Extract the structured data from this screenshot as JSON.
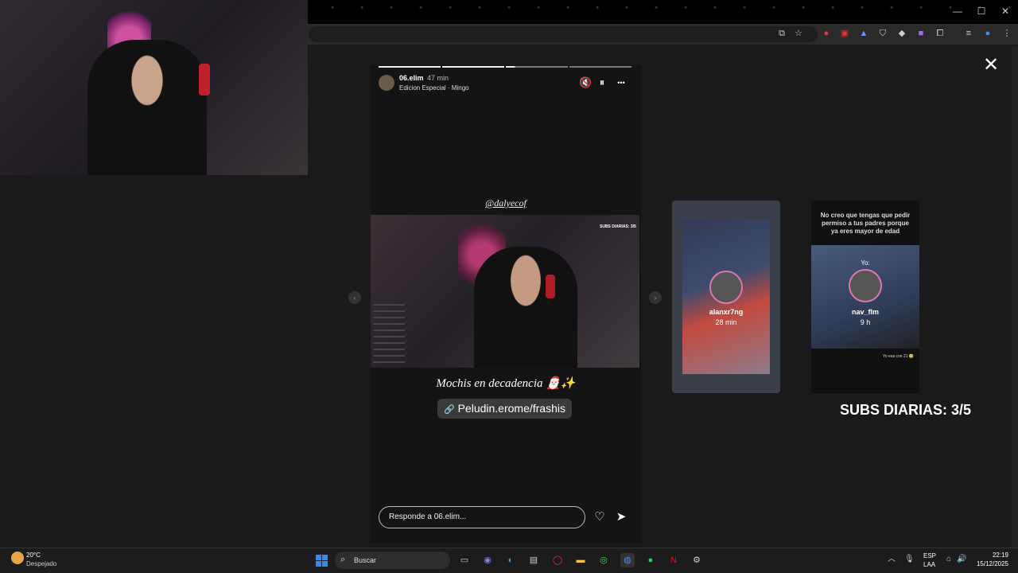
{
  "story": {
    "username": "06.elim",
    "time": "47 min",
    "music": "Edicion Especial · Mingo",
    "mention": "@dalyecof",
    "inner_subs": "SUBS DIARIAS: 3/5",
    "caption": "Mochis en decadencia 🎅🏻✨",
    "link": "Peludin.erome/frashis",
    "reply_placeholder": "Responde a 06.elim...",
    "progress_segments": 4,
    "active_segment": 3
  },
  "icons": {
    "mute": "🔇",
    "pause": "⏸",
    "more": "•••",
    "close": "✕",
    "heart": "♡",
    "send": "➤",
    "prev": "‹",
    "next": "›",
    "link": "🔗"
  },
  "previews": [
    {
      "name": "alanxr7ng",
      "time": "28 min"
    },
    {
      "name": "nav_flm",
      "time": "9 h",
      "text": "No creo que tengas que pedir permiso a tus padres porque ya eres mayor de edad",
      "yo": "Yo:",
      "footer": "Yo esa con 21 😊"
    }
  ],
  "overlay_label": "SUBS DIARIAS: 3/5",
  "taskbar": {
    "weather_temp": "20°C",
    "weather_desc": "Despejado",
    "search": "Buscar",
    "lang1": "ESP",
    "lang2": "LAA",
    "time": "22:19",
    "date": "15/12/2025"
  },
  "colors": {
    "accent": "#2a8cff",
    "background": "#1a1a1a"
  }
}
